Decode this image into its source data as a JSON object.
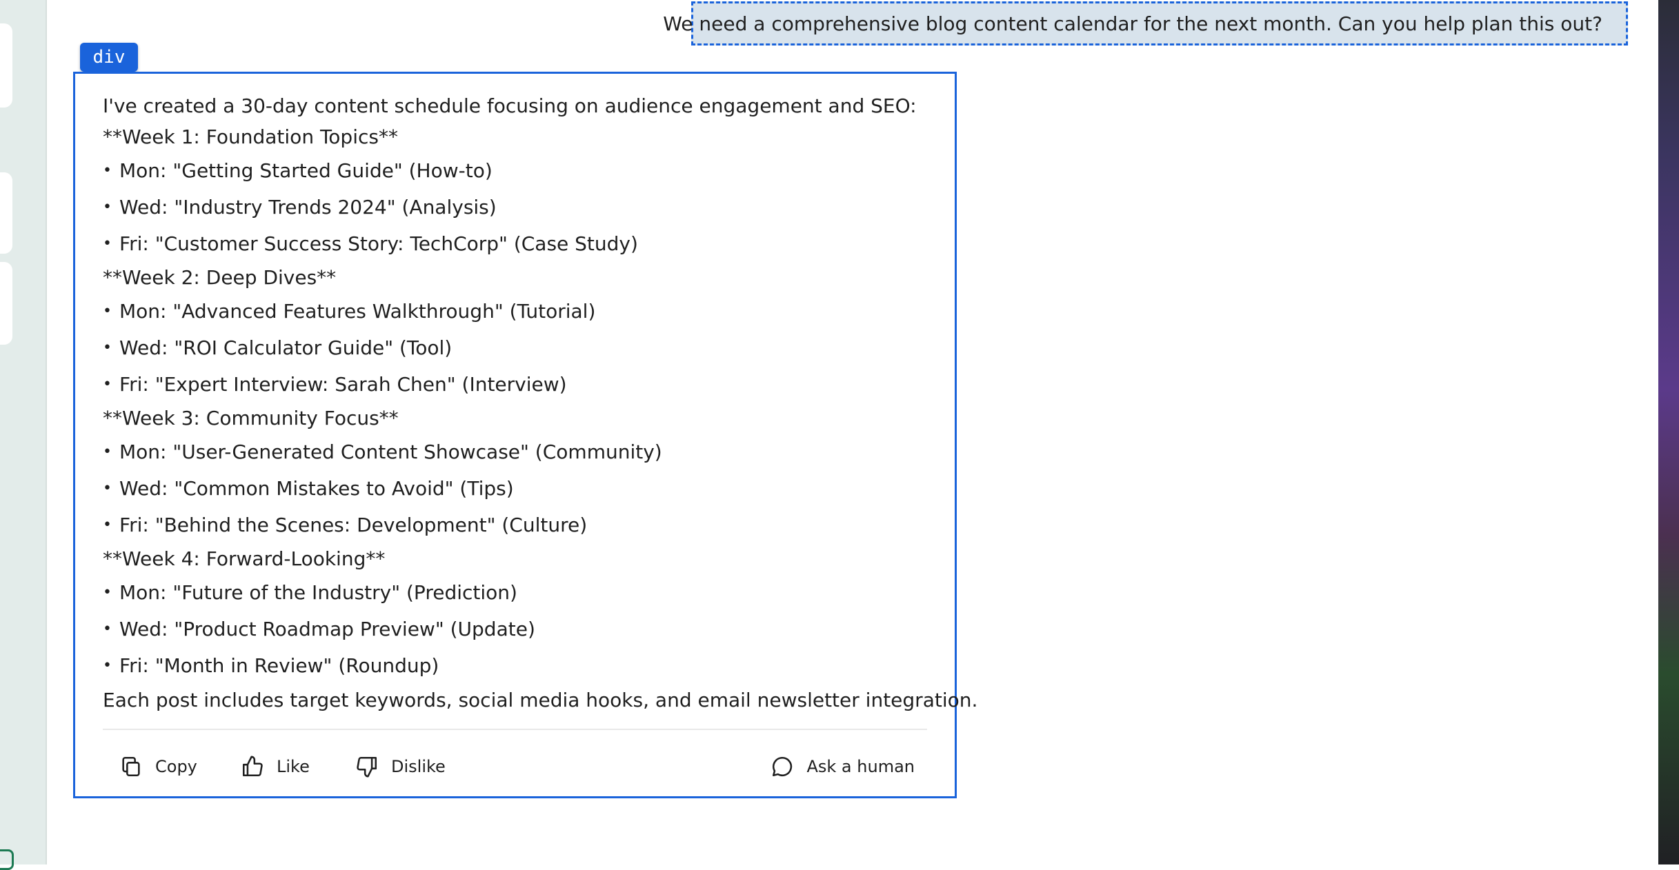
{
  "user_message": "We need a comprehensive blog content calendar for the next month. Can you help plan this out?",
  "inspector_tag": "div",
  "assistant": {
    "intro": "I've created a 30-day content schedule focusing on audience engagement and SEO:",
    "weeks": [
      {
        "heading": "**Week 1: Foundation Topics**",
        "items": [
          "Mon: \"Getting Started Guide\" (How-to)",
          "Wed: \"Industry Trends 2024\" (Analysis)",
          "Fri: \"Customer Success Story: TechCorp\" (Case Study)"
        ]
      },
      {
        "heading": "**Week 2: Deep Dives**",
        "items": [
          "Mon: \"Advanced Features Walkthrough\" (Tutorial)",
          "Wed: \"ROI Calculator Guide\" (Tool)",
          "Fri: \"Expert Interview: Sarah Chen\" (Interview)"
        ]
      },
      {
        "heading": "**Week 3: Community Focus**",
        "items": [
          "Mon: \"User-Generated Content Showcase\" (Community)",
          "Wed: \"Common Mistakes to Avoid\" (Tips)",
          "Fri: \"Behind the Scenes: Development\" (Culture)"
        ]
      },
      {
        "heading": "**Week 4: Forward-Looking**",
        "items": [
          "Mon: \"Future of the Industry\" (Prediction)",
          "Wed: \"Product Roadmap Preview\" (Update)",
          "Fri: \"Month in Review\" (Roundup)"
        ]
      }
    ],
    "outro": "Each post includes target keywords, social media hooks, and email newsletter integration."
  },
  "actions": {
    "copy_label": "Copy",
    "copy_icon": "copy-icon",
    "like_label": "Like",
    "like_icon": "thumbs-up-icon",
    "dislike_label": "Dislike",
    "dislike_icon": "thumbs-down-icon",
    "ask_label": "Ask a human",
    "ask_icon": "chat-bubble-icon"
  },
  "colors": {
    "accent": "#1a63db",
    "user_bubble_bg": "#d8e3ec",
    "sidebar_bg": "#e3ecea"
  }
}
